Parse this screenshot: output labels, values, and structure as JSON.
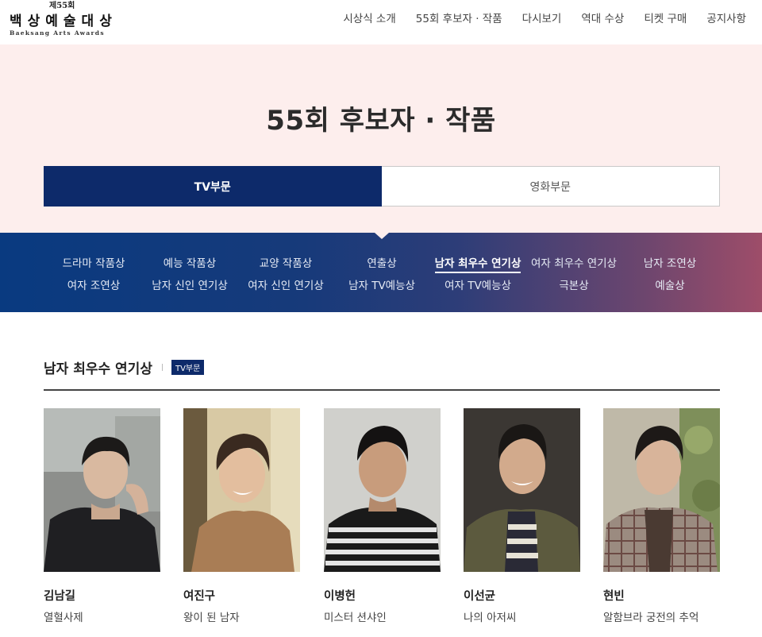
{
  "logo": {
    "top": "제55회",
    "main": "백상예술대상",
    "sub": "Baeksang Arts Awards"
  },
  "nav": [
    "시상식 소개",
    "55회 후보자 · 작품",
    "다시보기",
    "역대 수상",
    "티켓 구매",
    "공지사항"
  ],
  "hero": {
    "title": "55회 후보자 · 작품",
    "tabs": [
      {
        "label": "TV부문",
        "active": true
      },
      {
        "label": "영화부문",
        "active": false
      }
    ]
  },
  "categories": {
    "row1": [
      "드라마 작품상",
      "예능 작품상",
      "교양 작품상",
      "연출상",
      "남자 최우수 연기상",
      "여자 최우수 연기상",
      "남자 조연상"
    ],
    "row2": [
      "여자 조연상",
      "남자 신인 연기상",
      "여자 신인 연기상",
      "남자 TV예능상",
      "여자 TV예능상",
      "극본상",
      "예술상"
    ],
    "active": "남자 최우수 연기상"
  },
  "section": {
    "title": "남자 최우수 연기상",
    "badge": "TV부문"
  },
  "nominees": [
    {
      "name": "김남길",
      "work": "열혈사제"
    },
    {
      "name": "여진구",
      "work": "왕이 된 남자"
    },
    {
      "name": "이병헌",
      "work": "미스터 션샤인"
    },
    {
      "name": "이선균",
      "work": "나의 아저씨"
    },
    {
      "name": "현빈",
      "work": "알함브라 궁전의 추억"
    }
  ],
  "colors": {
    "navy": "#0d2a6a",
    "hero_bg": "#fdeeed",
    "band_start": "#093a80",
    "band_end": "#9e4d69"
  }
}
